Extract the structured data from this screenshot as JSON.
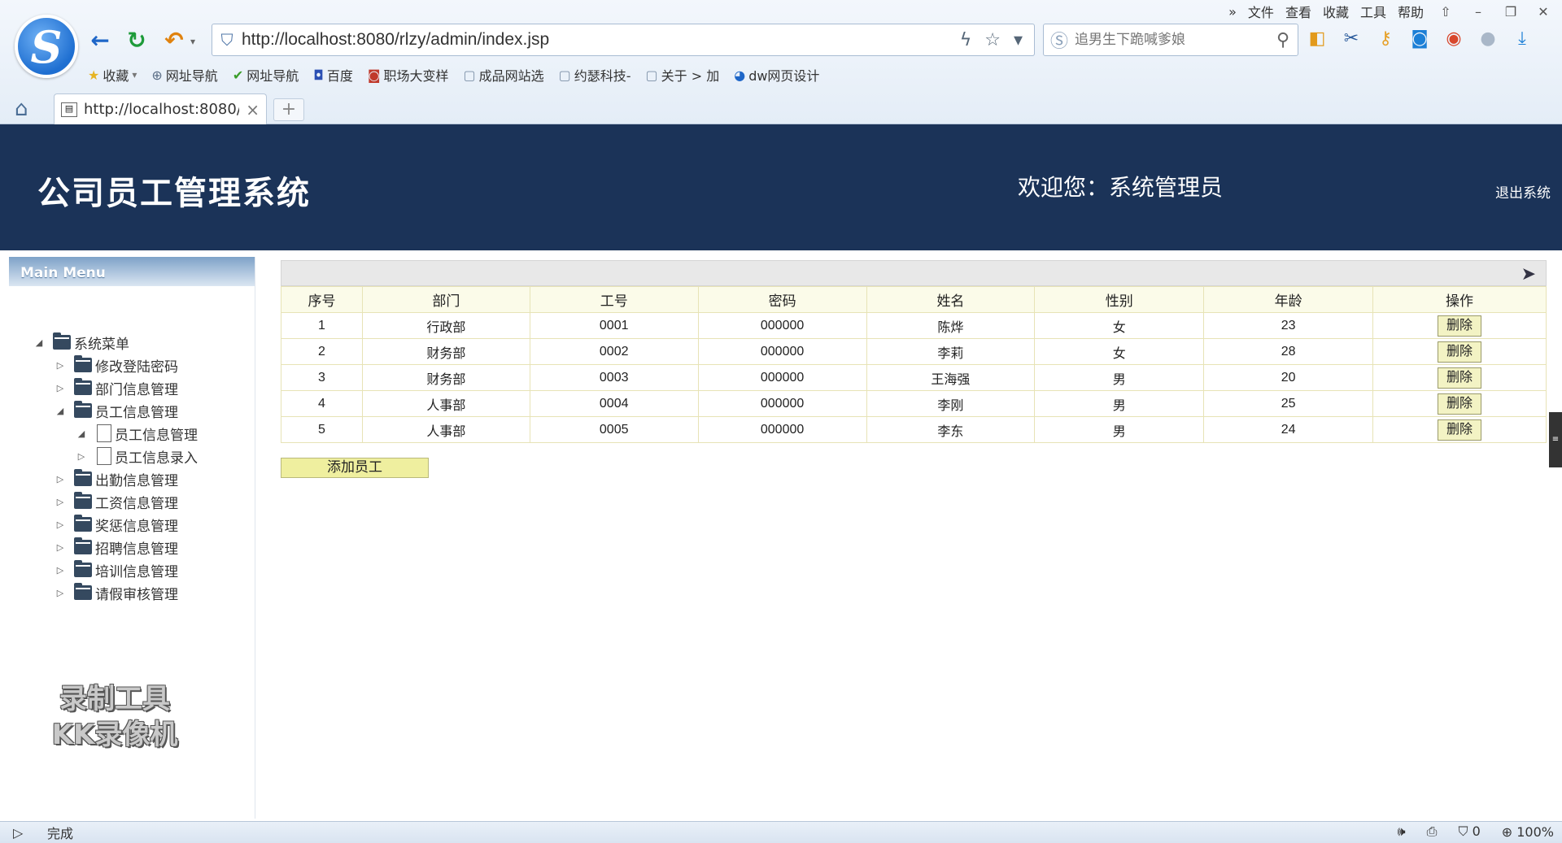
{
  "browser": {
    "menu": [
      "文件",
      "查看",
      "收藏",
      "工具",
      "帮助"
    ],
    "url": "http://localhost:8080/rlzy/admin/index.jsp",
    "search_placeholder": "追男生下跪喊爹娘",
    "favorites": [
      {
        "icon": "★",
        "label": "收藏",
        "caret": "▾"
      },
      {
        "icon": "⊕",
        "label": "网址导航"
      },
      {
        "icon": "✔",
        "label": "网址导航"
      },
      {
        "icon": "◘",
        "label": "百度"
      },
      {
        "icon": "◙",
        "label": "职场大变样"
      },
      {
        "icon": "▢",
        "label": "成品网站选"
      },
      {
        "icon": "▢",
        "label": "约瑟科技-"
      },
      {
        "icon": "▢",
        "label": "关于 > 加"
      },
      {
        "icon": "◕",
        "label": "dw网页设计"
      }
    ],
    "tab_title": "http://localhost:8080/r",
    "status_text": "完成",
    "status_count": "0",
    "zoom": "100%"
  },
  "header": {
    "system_title": "公司员工管理系统",
    "welcome": "欢迎您：系统管理员",
    "logout": "退出系统"
  },
  "sidebar": {
    "heading": "Main Menu",
    "root": "系统菜单",
    "items": [
      {
        "label": "修改登陆密码",
        "level": 1,
        "type": "folder",
        "expanded": false
      },
      {
        "label": "部门信息管理",
        "level": 1,
        "type": "folder",
        "expanded": false
      },
      {
        "label": "员工信息管理",
        "level": 1,
        "type": "folder",
        "expanded": true
      },
      {
        "label": "员工信息管理",
        "level": 2,
        "type": "doc",
        "expanded": true
      },
      {
        "label": "员工信息录入",
        "level": 2,
        "type": "doc",
        "expanded": false
      },
      {
        "label": "出勤信息管理",
        "level": 1,
        "type": "folder",
        "expanded": false
      },
      {
        "label": "工资信息管理",
        "level": 1,
        "type": "folder",
        "expanded": false
      },
      {
        "label": "奖惩信息管理",
        "level": 1,
        "type": "folder",
        "expanded": false
      },
      {
        "label": "招聘信息管理",
        "level": 1,
        "type": "folder",
        "expanded": false
      },
      {
        "label": "培训信息管理",
        "level": 1,
        "type": "folder",
        "expanded": false
      },
      {
        "label": "请假审核管理",
        "level": 1,
        "type": "folder",
        "expanded": false
      }
    ]
  },
  "watermark": [
    "录制工具",
    "KK录像机"
  ],
  "table": {
    "columns": [
      "序号",
      "部门",
      "工号",
      "密码",
      "姓名",
      "性别",
      "年龄",
      "操作"
    ],
    "rows": [
      [
        "1",
        "行政部",
        "0001",
        "000000",
        "陈烨",
        "女",
        "23"
      ],
      [
        "2",
        "财务部",
        "0002",
        "000000",
        "李莉",
        "女",
        "28"
      ],
      [
        "3",
        "财务部",
        "0003",
        "000000",
        "王海强",
        "男",
        "20"
      ],
      [
        "4",
        "人事部",
        "0004",
        "000000",
        "李刚",
        "男",
        "25"
      ],
      [
        "5",
        "人事部",
        "0005",
        "000000",
        "李东",
        "男",
        "24"
      ]
    ],
    "action_label": "删除"
  },
  "add_button": "添加员工",
  "colors": {
    "banner": "#1b3358",
    "header_row": "#fbfbe9",
    "button": "#f3f3c4"
  }
}
